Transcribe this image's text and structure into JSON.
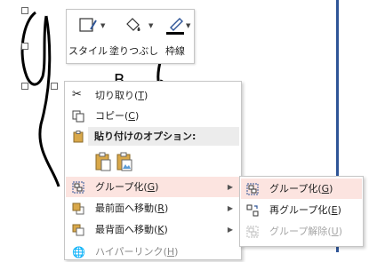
{
  "mini_toolbar": {
    "style_label": "スタイル",
    "fill_label": "塗りつぶし",
    "outline_label": "枠線"
  },
  "context_menu": {
    "cut": {
      "label": "切り取り",
      "key": "T"
    },
    "copy": {
      "label": "コピー",
      "key": "C"
    },
    "paste_options_header": "貼り付けのオプション:",
    "group": {
      "label": "グループ化",
      "key": "G"
    },
    "bring_front": {
      "label": "最前面へ移動",
      "key": "R"
    },
    "send_back": {
      "label": "最背面へ移動",
      "key": "K"
    },
    "hyperlink": {
      "label": "ハイパーリンク",
      "key": "H"
    }
  },
  "submenu": {
    "group": {
      "label": "グループ化",
      "key": "G"
    },
    "regroup": {
      "label": "再グループ化",
      "key": "E"
    },
    "ungroup": {
      "label": "グループ解除",
      "key": "U"
    }
  },
  "colors": {
    "highlight": "#fce4e0",
    "accent": "#2f5597",
    "disabled": "#a6a6a6"
  }
}
